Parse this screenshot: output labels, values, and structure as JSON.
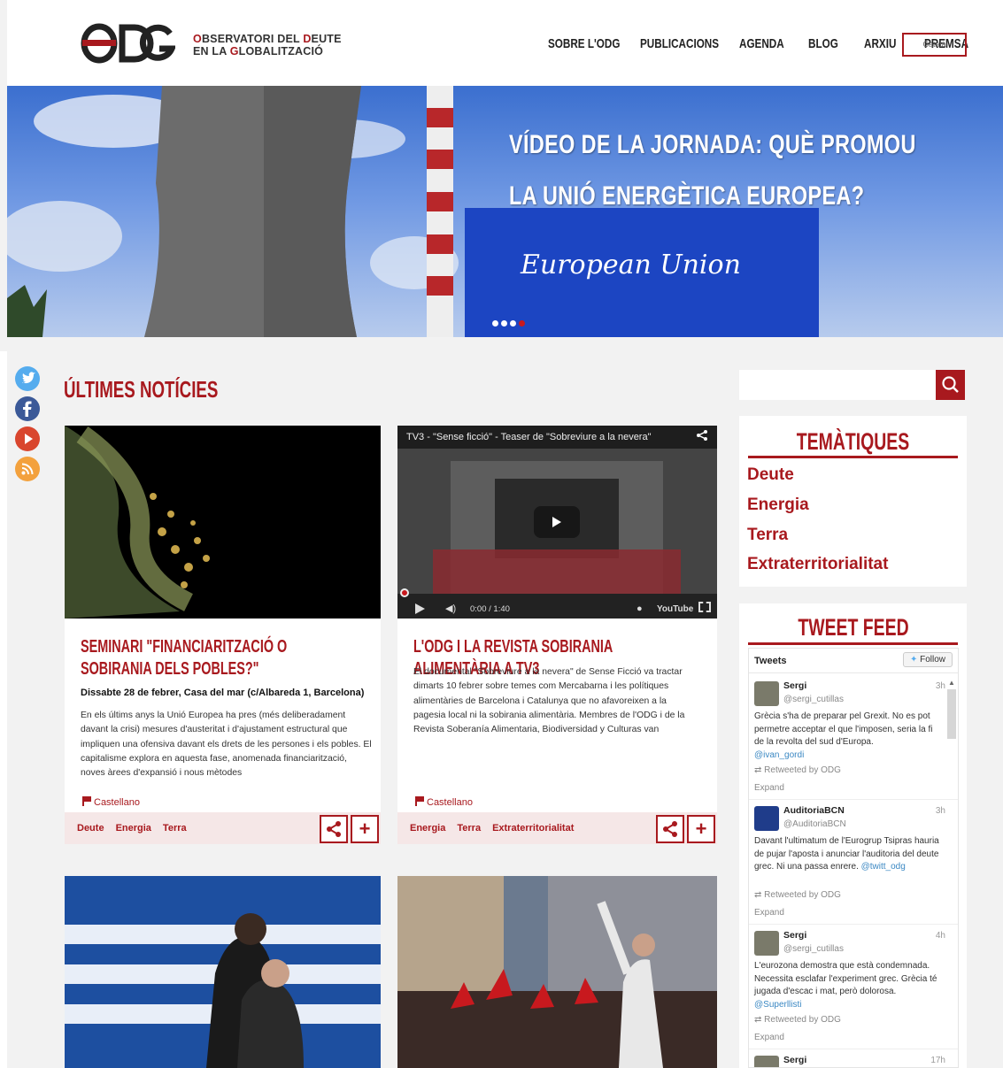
{
  "header": {
    "logo": "ODG",
    "org_line1_parts": [
      "O",
      "BSERVATORI DEL ",
      "D",
      "EUTE"
    ],
    "org_line2_parts": [
      "EN LA ",
      "G",
      "LOBALITZACIÓ"
    ],
    "nav": [
      "SOBRE L'ODG",
      "PUBLICACIONS",
      "AGENDA",
      "BLOG",
      "ARXIU",
      "PREMSA"
    ],
    "language": "Català"
  },
  "hero": {
    "title_line1": "VÍDEO DE LA JORNADA: QUÈ PROMOU",
    "title_line2": "LA UNIÓ ENERGÈTICA EUROPEA?",
    "sign_text": "European Union",
    "slide_count": 4,
    "active_slide": 4
  },
  "section": {
    "title": "ÚLTIMES NOTÍCIES"
  },
  "cards": [
    {
      "title": "SEMINARI \"FINANCIARITZACIÓ O SOBIRANIA DELS POBLES?\"",
      "subtitle": "Dissabte 28 de febrer, Casa del mar (c/Albareda 1, Barcelona)",
      "body": "En els últims anys la Unió Europea ha pres (més deliberadament davant la crisi) mesures d'austeritat i d'ajustament estructural que impliquen una ofensiva davant els drets de les persones i els pobles. El capitalisme explora en aquesta fase, anomenada financiarització, noves àrees d'expansió i nous mètodes",
      "lang": "Castellano",
      "tags": [
        "Deute",
        "Energia",
        "Terra"
      ]
    },
    {
      "title": "L'ODG I LA REVISTA SOBIRANIA ALIMENTÀRIA A TV3",
      "body": "El documental \"Sobreviure a la nevera\" de Sense Ficció va tractar dimarts 10 febrer sobre temes com Mercabarna i les polítiques alimentàries de Barcelona i Catalunya que no afavoreixen a la pagesia local ni la sobirania alimentària. Membres de l'ODG i de la Revista Soberanía Alimentaria, Biodiversidad y Culturas van",
      "lang": "Castellano",
      "tags": [
        "Energia",
        "Terra",
        "Extraterritorialitat"
      ],
      "video": {
        "title": "TV3 - \"Sense ficció\" - Teaser de \"Sobreviure a la nevera\"",
        "time": "0:00 / 1:40",
        "brand": "YouTube"
      }
    }
  ],
  "sidebar": {
    "themes_title": "TEMÀTIQUES",
    "themes": [
      "Deute",
      "Energia",
      "Terra",
      "Extraterritorialitat"
    ],
    "feed_title": "TWEET FEED",
    "tweets_label": "Tweets",
    "follow_label": "Follow",
    "tweets": [
      {
        "name": "Sergi",
        "handle": "@sergi_cutillas",
        "time": "3h",
        "text": "Grècia s'ha de preparar pel Grexit. No es pot permetre acceptar el que l'imposen, seria la fi de la revolta del sud d'Europa.",
        "mention": "@ivan_gordi",
        "rt": "Retweeted by ODG",
        "expand": "Expand"
      },
      {
        "name": "AuditoriaBCN",
        "handle": "@AuditoriaBCN",
        "time": "3h",
        "text": "Davant l'ultimatum de l'Eurogrup Tsipras hauria de pujar l'aposta i anunciar l'auditoria del deute grec. Ni una passa enrere.",
        "mention": "@twitt_odg",
        "rt": "Retweeted by ODG",
        "expand": "Expand"
      },
      {
        "name": "Sergi",
        "handle": "@sergi_cutillas",
        "time": "4h",
        "text": "L'eurozona demostra que està condemnada. Necessita esclafar l'experiment grec. Grècia té jugada d'escac i mat, però dolorosa.",
        "mention": "@Superllisti",
        "rt": "Retweeted by ODG",
        "expand": "Expand"
      },
      {
        "name": "Sergi",
        "time": "17h"
      }
    ]
  },
  "colors": {
    "brand": "#a8191e",
    "twitter": "#55acee",
    "link": "#3b88c3"
  },
  "social_icons": [
    "twitter-icon",
    "facebook-icon",
    "youtube-icon",
    "rss-icon"
  ]
}
